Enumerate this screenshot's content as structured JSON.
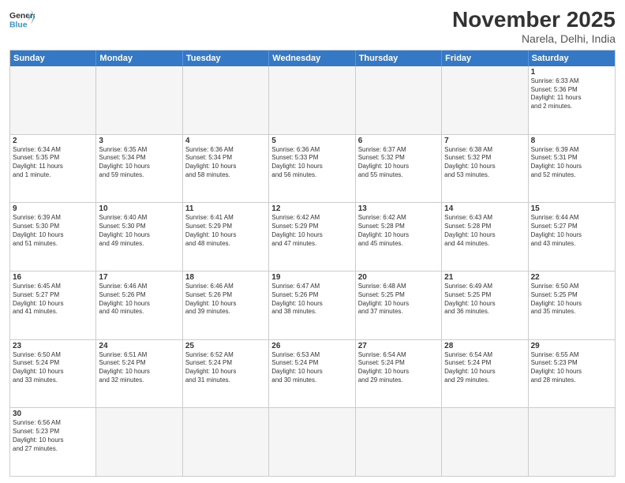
{
  "header": {
    "logo_general": "General",
    "logo_blue": "Blue",
    "month_title": "November 2025",
    "location": "Narela, Delhi, India"
  },
  "days_of_week": [
    "Sunday",
    "Monday",
    "Tuesday",
    "Wednesday",
    "Thursday",
    "Friday",
    "Saturday"
  ],
  "weeks": [
    [
      {
        "day": "",
        "info": ""
      },
      {
        "day": "",
        "info": ""
      },
      {
        "day": "",
        "info": ""
      },
      {
        "day": "",
        "info": ""
      },
      {
        "day": "",
        "info": ""
      },
      {
        "day": "",
        "info": ""
      },
      {
        "day": "1",
        "info": "Sunrise: 6:33 AM\nSunset: 5:36 PM\nDaylight: 11 hours\nand 2 minutes."
      }
    ],
    [
      {
        "day": "2",
        "info": "Sunrise: 6:34 AM\nSunset: 5:35 PM\nDaylight: 11 hours\nand 1 minute."
      },
      {
        "day": "3",
        "info": "Sunrise: 6:35 AM\nSunset: 5:34 PM\nDaylight: 10 hours\nand 59 minutes."
      },
      {
        "day": "4",
        "info": "Sunrise: 6:36 AM\nSunset: 5:34 PM\nDaylight: 10 hours\nand 58 minutes."
      },
      {
        "day": "5",
        "info": "Sunrise: 6:36 AM\nSunset: 5:33 PM\nDaylight: 10 hours\nand 56 minutes."
      },
      {
        "day": "6",
        "info": "Sunrise: 6:37 AM\nSunset: 5:32 PM\nDaylight: 10 hours\nand 55 minutes."
      },
      {
        "day": "7",
        "info": "Sunrise: 6:38 AM\nSunset: 5:32 PM\nDaylight: 10 hours\nand 53 minutes."
      },
      {
        "day": "8",
        "info": "Sunrise: 6:39 AM\nSunset: 5:31 PM\nDaylight: 10 hours\nand 52 minutes."
      }
    ],
    [
      {
        "day": "9",
        "info": "Sunrise: 6:39 AM\nSunset: 5:30 PM\nDaylight: 10 hours\nand 51 minutes."
      },
      {
        "day": "10",
        "info": "Sunrise: 6:40 AM\nSunset: 5:30 PM\nDaylight: 10 hours\nand 49 minutes."
      },
      {
        "day": "11",
        "info": "Sunrise: 6:41 AM\nSunset: 5:29 PM\nDaylight: 10 hours\nand 48 minutes."
      },
      {
        "day": "12",
        "info": "Sunrise: 6:42 AM\nSunset: 5:29 PM\nDaylight: 10 hours\nand 47 minutes."
      },
      {
        "day": "13",
        "info": "Sunrise: 6:42 AM\nSunset: 5:28 PM\nDaylight: 10 hours\nand 45 minutes."
      },
      {
        "day": "14",
        "info": "Sunrise: 6:43 AM\nSunset: 5:28 PM\nDaylight: 10 hours\nand 44 minutes."
      },
      {
        "day": "15",
        "info": "Sunrise: 6:44 AM\nSunset: 5:27 PM\nDaylight: 10 hours\nand 43 minutes."
      }
    ],
    [
      {
        "day": "16",
        "info": "Sunrise: 6:45 AM\nSunset: 5:27 PM\nDaylight: 10 hours\nand 41 minutes."
      },
      {
        "day": "17",
        "info": "Sunrise: 6:46 AM\nSunset: 5:26 PM\nDaylight: 10 hours\nand 40 minutes."
      },
      {
        "day": "18",
        "info": "Sunrise: 6:46 AM\nSunset: 5:26 PM\nDaylight: 10 hours\nand 39 minutes."
      },
      {
        "day": "19",
        "info": "Sunrise: 6:47 AM\nSunset: 5:26 PM\nDaylight: 10 hours\nand 38 minutes."
      },
      {
        "day": "20",
        "info": "Sunrise: 6:48 AM\nSunset: 5:25 PM\nDaylight: 10 hours\nand 37 minutes."
      },
      {
        "day": "21",
        "info": "Sunrise: 6:49 AM\nSunset: 5:25 PM\nDaylight: 10 hours\nand 36 minutes."
      },
      {
        "day": "22",
        "info": "Sunrise: 6:50 AM\nSunset: 5:25 PM\nDaylight: 10 hours\nand 35 minutes."
      }
    ],
    [
      {
        "day": "23",
        "info": "Sunrise: 6:50 AM\nSunset: 5:24 PM\nDaylight: 10 hours\nand 33 minutes."
      },
      {
        "day": "24",
        "info": "Sunrise: 6:51 AM\nSunset: 5:24 PM\nDaylight: 10 hours\nand 32 minutes."
      },
      {
        "day": "25",
        "info": "Sunrise: 6:52 AM\nSunset: 5:24 PM\nDaylight: 10 hours\nand 31 minutes."
      },
      {
        "day": "26",
        "info": "Sunrise: 6:53 AM\nSunset: 5:24 PM\nDaylight: 10 hours\nand 30 minutes."
      },
      {
        "day": "27",
        "info": "Sunrise: 6:54 AM\nSunset: 5:24 PM\nDaylight: 10 hours\nand 29 minutes."
      },
      {
        "day": "28",
        "info": "Sunrise: 6:54 AM\nSunset: 5:24 PM\nDaylight: 10 hours\nand 29 minutes."
      },
      {
        "day": "29",
        "info": "Sunrise: 6:55 AM\nSunset: 5:23 PM\nDaylight: 10 hours\nand 28 minutes."
      }
    ],
    [
      {
        "day": "30",
        "info": "Sunrise: 6:56 AM\nSunset: 5:23 PM\nDaylight: 10 hours\nand 27 minutes."
      },
      {
        "day": "",
        "info": ""
      },
      {
        "day": "",
        "info": ""
      },
      {
        "day": "",
        "info": ""
      },
      {
        "day": "",
        "info": ""
      },
      {
        "day": "",
        "info": ""
      },
      {
        "day": "",
        "info": ""
      }
    ]
  ]
}
